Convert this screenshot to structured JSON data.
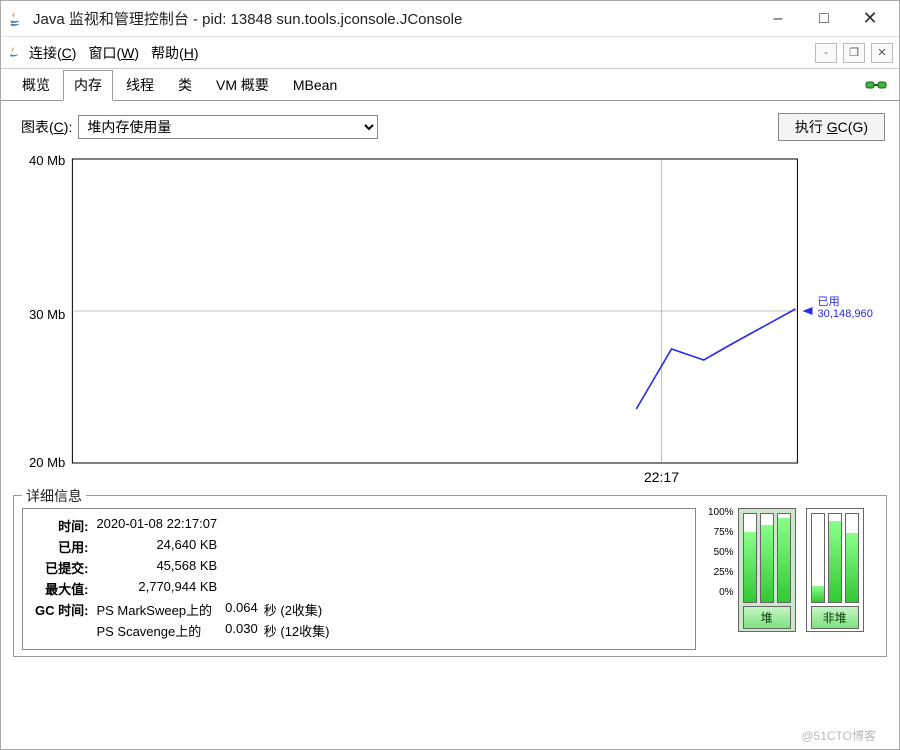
{
  "window": {
    "title": "Java 监视和管理控制台 - pid: 13848 sun.tools.jconsole.JConsole"
  },
  "menus": {
    "connect": "连接(C)",
    "window": "窗口(W)",
    "help": "帮助(H)"
  },
  "tabs": {
    "items": [
      {
        "label": "概览"
      },
      {
        "label": "内存"
      },
      {
        "label": "线程"
      },
      {
        "label": "类"
      },
      {
        "label": "VM 概要"
      },
      {
        "label": "MBean"
      }
    ],
    "active_index": 1
  },
  "chart_selector": {
    "label": "图表(C):",
    "value": "堆内存使用量"
  },
  "gc_button": {
    "label_prefix": "执行 ",
    "mnemonic": "G",
    "label_suffix": "C(G)"
  },
  "chart_data": {
    "type": "line",
    "title": "",
    "ylabel": "Mb",
    "ylim": [
      20,
      40
    ],
    "yticks": [
      20,
      30,
      40
    ],
    "ytick_labels": [
      "20 Mb",
      "30 Mb",
      "40 Mb"
    ],
    "x_tick_label": "22:17",
    "annotation": {
      "label_top": "已用",
      "label_value": "30,148,960"
    },
    "series": [
      {
        "name": "已用",
        "x": [
          0,
          1,
          2,
          3,
          4
        ],
        "values_mb": [
          23.5,
          27.5,
          26.8,
          27.8,
          30.15
        ]
      }
    ]
  },
  "details": {
    "panel_title": "详细信息",
    "labels": {
      "time": "时间:",
      "used": "已用:",
      "committed": "已提交:",
      "max": "最大值:",
      "gc_time": "GC 时间:"
    },
    "values": {
      "time": "2020-01-08 22:17:07",
      "used": "24,640 KB",
      "committed": "45,568 KB",
      "max": "2,770,944 KB"
    },
    "gc": [
      {
        "collector": "PS MarkSweep上的",
        "seconds": "0.064",
        "unit": "秒",
        "collections": "(2收集)"
      },
      {
        "collector": "PS Scavenge上的",
        "seconds": "0.030",
        "unit": "秒",
        "collections": "(12收集)"
      }
    ]
  },
  "memory_bars": {
    "scale": [
      "100%",
      "75%",
      "50%",
      "25%",
      "0%"
    ],
    "groups": [
      {
        "name": "heap",
        "label": "堆",
        "bars_pct": [
          80,
          88,
          95
        ]
      },
      {
        "name": "nonheap",
        "label": "非堆",
        "bars_pct": [
          18,
          92,
          78
        ]
      }
    ]
  },
  "watermark": "@51CTO博客"
}
